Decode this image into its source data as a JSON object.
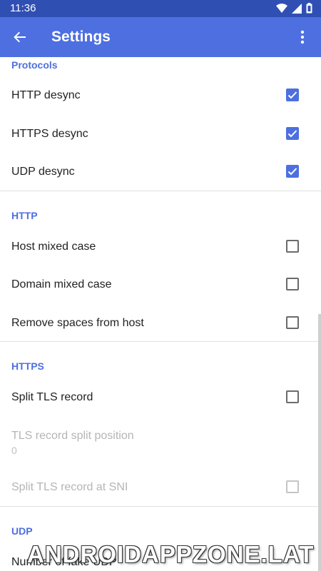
{
  "status_bar": {
    "time": "11:36"
  },
  "app_bar": {
    "title": "Settings"
  },
  "sections": {
    "protocols": {
      "header": "Protocols",
      "items": [
        {
          "label": "HTTP desync",
          "checked": true
        },
        {
          "label": "HTTPS desync",
          "checked": true
        },
        {
          "label": "UDP desync",
          "checked": true
        }
      ]
    },
    "http": {
      "header": "HTTP",
      "items": [
        {
          "label": "Host mixed case",
          "checked": false
        },
        {
          "label": "Domain mixed case",
          "checked": false
        },
        {
          "label": "Remove spaces from host",
          "checked": false
        }
      ]
    },
    "https": {
      "header": "HTTPS",
      "split_tls": {
        "label": "Split TLS record",
        "checked": false
      },
      "split_position": {
        "label": "TLS record split position",
        "value": "0"
      },
      "split_sni": {
        "label": "Split TLS record at SNI",
        "checked": false,
        "enabled": false
      }
    },
    "udp": {
      "header": "UDP",
      "items": [
        {
          "label": "Number of fake UDP"
        }
      ]
    }
  },
  "watermark": "ANDROIDAPPZONE.LAT",
  "colors": {
    "accent": "#4d6fe0",
    "status_bar": "#2f4fb3",
    "divider": "#e0e0e0"
  },
  "icons": {
    "back": "arrow-left-icon",
    "overflow": "more-vert-icon",
    "wifi": "wifi-icon",
    "signal": "signal-icon",
    "battery": "battery-icon"
  }
}
